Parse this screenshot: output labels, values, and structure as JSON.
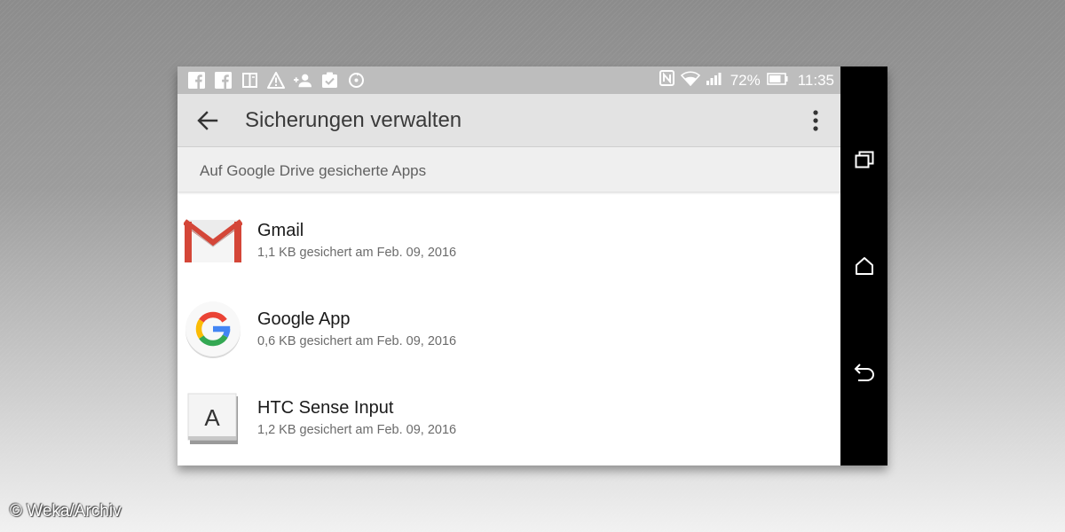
{
  "status_bar": {
    "left_icons": [
      "facebook-icon",
      "facebook-icon",
      "book-icon",
      "warning-icon",
      "add-contact-icon",
      "task-check-icon",
      "sync-icon"
    ],
    "right_icons": [
      "nfc-icon",
      "wifi-icon",
      "signal-icon",
      "battery-icon"
    ],
    "battery_percent": "72%",
    "time": "11:35"
  },
  "app_bar": {
    "back_icon": "arrow-back-icon",
    "title": "Sicherungen verwalten",
    "overflow_icon": "more-vert-icon"
  },
  "section_header": "Auf Google Drive gesicherte Apps",
  "apps": [
    {
      "name": "Gmail",
      "detail": "1,1 KB gesichert am Feb. 09, 2016",
      "icon": "gmail-icon"
    },
    {
      "name": "Google App",
      "detail": "0,6 KB gesichert am Feb. 09, 2016",
      "icon": "google-icon"
    },
    {
      "name": "HTC Sense Input",
      "detail": "1,2 KB gesichert am Feb. 09, 2016",
      "icon": "htc-sense-input-icon",
      "icon_letter": "A"
    }
  ],
  "nav_bar": {
    "buttons": [
      "recents-icon",
      "home-icon",
      "back-nav-icon"
    ]
  },
  "watermark": "© Weka/Archiv",
  "colors": {
    "status_bar": "#bdbdbd",
    "app_bar": "#e3e3e3",
    "section_header": "#efefef",
    "nav_bar": "#000000",
    "gmail_red": "#d44638",
    "google_blue": "#4285f4",
    "google_red": "#ea4335",
    "google_yellow": "#fbbc05",
    "google_green": "#34a853"
  }
}
